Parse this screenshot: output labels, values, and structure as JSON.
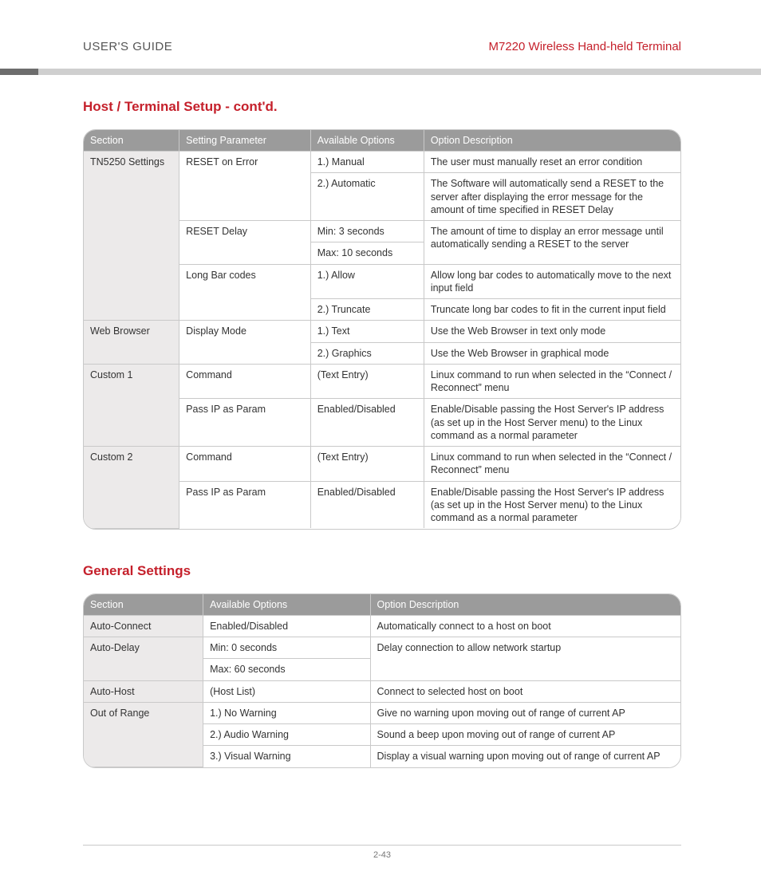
{
  "header": {
    "left": "USER'S GUIDE",
    "right": "M7220 Wireless Hand-held Terminal"
  },
  "section1_title": "Host / Terminal Setup - cont'd.",
  "table1": {
    "headers": [
      "Section",
      "Setting Parameter",
      "Available Options",
      "Option Description"
    ],
    "rows": [
      {
        "section": "TN5250 Settings",
        "param": "RESET on Error",
        "option": "1.) Manual",
        "desc": "The user must manually reset an error condition",
        "secRowspan": 6,
        "paramRowspan": 2
      },
      {
        "option": "2.) Automatic",
        "desc": "The Software will automatically send a RESET to the server after displaying the error message for the amount of time specified in RESET Delay"
      },
      {
        "param": "RESET Delay",
        "option": "Min: 3 seconds",
        "desc": "The amount of time to display an error message until automatically sending a RESET to the server",
        "paramRowspan": 2,
        "descRowspan": 2
      },
      {
        "option": "Max: 10 seconds"
      },
      {
        "param": "Long Bar codes",
        "option": "1.) Allow",
        "desc": "Allow long bar codes to automatically move to the next input field",
        "paramRowspan": 2
      },
      {
        "option": "2.) Truncate",
        "desc": "Truncate long bar codes to fit in the current input field"
      },
      {
        "section": "Web Browser",
        "param": "Display Mode",
        "option": "1.) Text",
        "desc": "Use the Web Browser in text only mode",
        "secRowspan": 2,
        "paramRowspan": 2
      },
      {
        "option": "2.) Graphics",
        "desc": "Use the Web Browser in graphical mode"
      },
      {
        "section": "Custom 1",
        "param": "Command",
        "option": "(Text Entry)",
        "desc": "Linux command to run when selected in the “Connect / Reconnect” menu",
        "secRowspan": 2
      },
      {
        "param": "Pass IP as Param",
        "option": "Enabled/Disabled",
        "desc": "Enable/Disable passing the Host Server's IP address (as set up in the Host Server menu) to the Linux command as a normal parameter"
      },
      {
        "section": "Custom 2",
        "param": "Command",
        "option": "(Text Entry)",
        "desc": "Linux command to run when selected in the “Connect / Reconnect” menu",
        "secRowspan": 2
      },
      {
        "param": "Pass IP as Param",
        "option": "Enabled/Disabled",
        "desc": "Enable/Disable passing the Host Server's IP address (as set up in the Host Server menu) to the Linux command as a normal parameter"
      }
    ]
  },
  "section2_title": "General Settings",
  "table2": {
    "headers": [
      "Section",
      "Available Options",
      "Option Description"
    ],
    "rows": [
      {
        "section": "Auto-Connect",
        "option": "Enabled/Disabled",
        "desc": "Automatically connect to a host on boot"
      },
      {
        "section": "Auto-Delay",
        "option": "Min: 0 seconds",
        "desc": "Delay connection to allow network startup",
        "secRowspan": 2,
        "descRowspan": 2
      },
      {
        "option": "Max: 60 seconds"
      },
      {
        "section": "Auto-Host",
        "option": "(Host List)",
        "desc": "Connect to selected host on boot"
      },
      {
        "section": "Out of Range",
        "option": "1.) No Warning",
        "desc": "Give no warning upon moving out of range of current AP",
        "secRowspan": 3
      },
      {
        "option": "2.) Audio Warning",
        "desc": "Sound a beep upon moving out of range of current AP"
      },
      {
        "option": "3.) Visual Warning",
        "desc": "Display a visual warning upon moving out of range of current AP"
      }
    ]
  },
  "page_number": "2-43",
  "col_widths": {
    "t1": [
      "16%",
      "22%",
      "19%",
      "43%"
    ],
    "t2": [
      "20%",
      "28%",
      "52%"
    ]
  }
}
